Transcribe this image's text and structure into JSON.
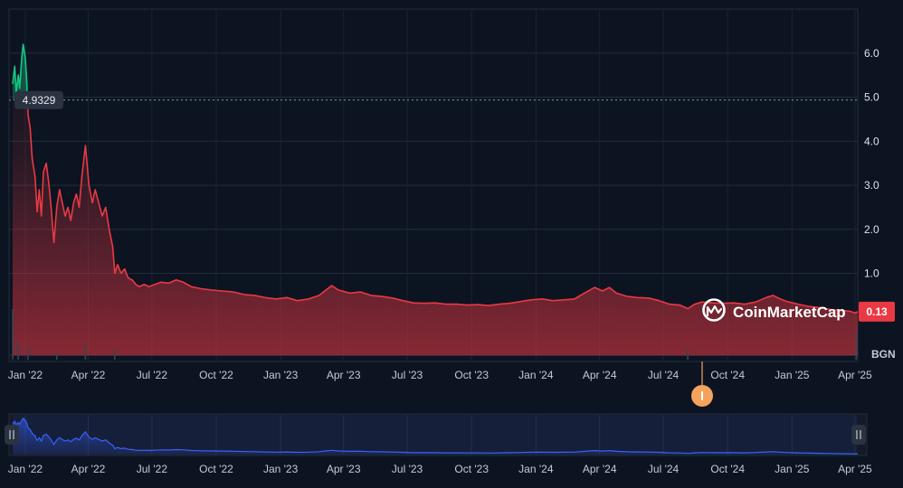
{
  "chart_data": {
    "type": "area",
    "currency": "BGN",
    "brand": "CoinMarketCap",
    "open_value_label": "4.9329",
    "last_value_label": "0.13",
    "ylim": [
      -1.0,
      7.0
    ],
    "yticks": [
      "1.0",
      "2.0",
      "3.0",
      "4.0",
      "5.0",
      "6.0"
    ],
    "ytick_values": [
      1,
      2,
      3,
      4,
      5,
      6
    ],
    "x_ticks": [
      "Jan '22",
      "Apr '22",
      "Jul '22",
      "Oct '22",
      "Jan '23",
      "Apr '23",
      "Jul '23",
      "Oct '23",
      "Jan '24",
      "Apr '24",
      "Jul '24",
      "Oct '24",
      "Jan '25",
      "Apr '25"
    ],
    "x_tick_dates": [
      "2022-01-01",
      "2022-04-01",
      "2022-07-01",
      "2022-10-01",
      "2023-01-01",
      "2023-04-01",
      "2023-07-01",
      "2023-10-01",
      "2024-01-01",
      "2024-04-01",
      "2024-07-01",
      "2024-10-01",
      "2025-01-01",
      "2025-04-01"
    ],
    "x_range": [
      "2021-12-14",
      "2025-04-05"
    ],
    "reference_value": 4.9329,
    "series": [
      {
        "up_color": "#16c784",
        "down_color": "#ea3943",
        "points": [
          [
            "2021-12-14",
            5.3
          ],
          [
            "2021-12-17",
            5.7
          ],
          [
            "2021-12-19",
            5.1
          ],
          [
            "2021-12-22",
            5.5
          ],
          [
            "2021-12-24",
            5.2
          ],
          [
            "2021-12-27",
            5.9
          ],
          [
            "2021-12-29",
            6.2
          ],
          [
            "2022-01-01",
            5.9
          ],
          [
            "2022-01-03",
            5.4
          ],
          [
            "2022-01-05",
            4.6
          ],
          [
            "2022-01-08",
            4.3
          ],
          [
            "2022-01-11",
            3.6
          ],
          [
            "2022-01-15",
            3.2
          ],
          [
            "2022-01-18",
            2.4
          ],
          [
            "2022-01-21",
            2.9
          ],
          [
            "2022-01-24",
            2.3
          ],
          [
            "2022-01-27",
            3.3
          ],
          [
            "2022-01-31",
            3.5
          ],
          [
            "2022-02-04",
            3.0
          ],
          [
            "2022-02-07",
            2.5
          ],
          [
            "2022-02-11",
            1.7
          ],
          [
            "2022-02-15",
            2.5
          ],
          [
            "2022-02-19",
            2.9
          ],
          [
            "2022-02-23",
            2.6
          ],
          [
            "2022-02-27",
            2.3
          ],
          [
            "2022-03-03",
            2.5
          ],
          [
            "2022-03-07",
            2.2
          ],
          [
            "2022-03-11",
            2.6
          ],
          [
            "2022-03-15",
            2.8
          ],
          [
            "2022-03-19",
            2.5
          ],
          [
            "2022-03-23",
            3.2
          ],
          [
            "2022-03-28",
            3.9
          ],
          [
            "2022-04-02",
            3.0
          ],
          [
            "2022-04-07",
            2.6
          ],
          [
            "2022-04-11",
            2.9
          ],
          [
            "2022-04-16",
            2.6
          ],
          [
            "2022-04-21",
            2.3
          ],
          [
            "2022-04-26",
            2.5
          ],
          [
            "2022-05-01",
            2.0
          ],
          [
            "2022-05-06",
            1.6
          ],
          [
            "2022-05-09",
            1.0
          ],
          [
            "2022-05-13",
            1.2
          ],
          [
            "2022-05-18",
            1.0
          ],
          [
            "2022-05-23",
            1.1
          ],
          [
            "2022-05-28",
            0.9
          ],
          [
            "2022-06-03",
            0.85
          ],
          [
            "2022-06-08",
            0.75
          ],
          [
            "2022-06-13",
            0.7
          ],
          [
            "2022-06-20",
            0.75
          ],
          [
            "2022-06-27",
            0.7
          ],
          [
            "2022-07-05",
            0.75
          ],
          [
            "2022-07-14",
            0.8
          ],
          [
            "2022-07-25",
            0.78
          ],
          [
            "2022-08-05",
            0.85
          ],
          [
            "2022-08-15",
            0.8
          ],
          [
            "2022-08-26",
            0.7
          ],
          [
            "2022-09-10",
            0.65
          ],
          [
            "2022-09-25",
            0.62
          ],
          [
            "2022-10-10",
            0.6
          ],
          [
            "2022-10-25",
            0.58
          ],
          [
            "2022-11-10",
            0.52
          ],
          [
            "2022-11-25",
            0.5
          ],
          [
            "2022-12-10",
            0.45
          ],
          [
            "2022-12-25",
            0.42
          ],
          [
            "2023-01-10",
            0.45
          ],
          [
            "2023-01-25",
            0.38
          ],
          [
            "2023-02-10",
            0.42
          ],
          [
            "2023-02-25",
            0.5
          ],
          [
            "2023-03-05",
            0.6
          ],
          [
            "2023-03-15",
            0.72
          ],
          [
            "2023-03-25",
            0.62
          ],
          [
            "2023-04-10",
            0.55
          ],
          [
            "2023-04-25",
            0.58
          ],
          [
            "2023-05-10",
            0.5
          ],
          [
            "2023-05-25",
            0.48
          ],
          [
            "2023-06-10",
            0.44
          ],
          [
            "2023-06-25",
            0.38
          ],
          [
            "2023-07-10",
            0.33
          ],
          [
            "2023-07-25",
            0.32
          ],
          [
            "2023-08-10",
            0.33
          ],
          [
            "2023-08-25",
            0.3
          ],
          [
            "2023-09-10",
            0.3
          ],
          [
            "2023-09-25",
            0.28
          ],
          [
            "2023-10-10",
            0.29
          ],
          [
            "2023-10-25",
            0.27
          ],
          [
            "2023-11-10",
            0.3
          ],
          [
            "2023-11-25",
            0.32
          ],
          [
            "2023-12-10",
            0.36
          ],
          [
            "2023-12-25",
            0.4
          ],
          [
            "2024-01-10",
            0.42
          ],
          [
            "2024-01-25",
            0.38
          ],
          [
            "2024-02-10",
            0.4
          ],
          [
            "2024-02-25",
            0.42
          ],
          [
            "2024-03-10",
            0.55
          ],
          [
            "2024-03-25",
            0.68
          ],
          [
            "2024-04-05",
            0.6
          ],
          [
            "2024-04-15",
            0.68
          ],
          [
            "2024-04-25",
            0.55
          ],
          [
            "2024-05-10",
            0.48
          ],
          [
            "2024-05-25",
            0.45
          ],
          [
            "2024-06-10",
            0.44
          ],
          [
            "2024-06-25",
            0.38
          ],
          [
            "2024-07-10",
            0.3
          ],
          [
            "2024-07-25",
            0.28
          ],
          [
            "2024-08-05",
            0.2
          ],
          [
            "2024-08-15",
            0.3
          ],
          [
            "2024-08-25",
            0.35
          ],
          [
            "2024-09-10",
            0.33
          ],
          [
            "2024-09-25",
            0.32
          ],
          [
            "2024-10-10",
            0.33
          ],
          [
            "2024-10-25",
            0.3
          ],
          [
            "2024-11-10",
            0.35
          ],
          [
            "2024-11-25",
            0.45
          ],
          [
            "2024-12-05",
            0.5
          ],
          [
            "2024-12-15",
            0.42
          ],
          [
            "2024-12-25",
            0.36
          ],
          [
            "2025-01-10",
            0.3
          ],
          [
            "2025-01-25",
            0.25
          ],
          [
            "2025-02-10",
            0.22
          ],
          [
            "2025-02-25",
            0.18
          ],
          [
            "2025-03-10",
            0.16
          ],
          [
            "2025-03-25",
            0.14
          ],
          [
            "2025-04-01",
            0.1
          ],
          [
            "2025-04-05",
            0.13
          ]
        ]
      }
    ],
    "volume_spikes": [
      [
        "2021-12-14",
        1.0
      ],
      [
        "2021-12-22",
        0.35
      ],
      [
        "2022-01-05",
        0.25
      ],
      [
        "2022-02-15",
        0.15
      ],
      [
        "2022-03-28",
        0.3
      ],
      [
        "2022-05-09",
        0.2
      ],
      [
        "2024-08-05",
        0.2
      ],
      [
        "2025-04-03",
        0.55
      ]
    ]
  }
}
